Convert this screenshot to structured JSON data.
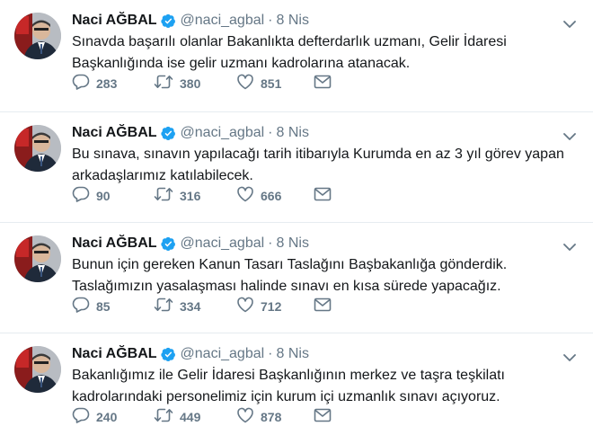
{
  "tweets": [
    {
      "name": "Naci AĞBAL",
      "handle": "@naci_agbal",
      "dot": "·",
      "time": "8 Nis",
      "line1": "Sınavda başarılı olanlar Bakanlıkta defterdarlık uzmanı, Gelir İdaresi",
      "line2": "Başkanlığında ise gelir uzmanı kadrolarına atanacak.",
      "replies": "283",
      "retweets": "380",
      "likes": "851"
    },
    {
      "name": "Naci AĞBAL",
      "handle": "@naci_agbal",
      "dot": "·",
      "time": "8 Nis",
      "line1": "Bu sınava, sınavın yapılacağı tarih itibarıyla Kurumda en az 3 yıl görev yapan",
      "line2": "arkadaşlarımız katılabilecek.",
      "replies": "90",
      "retweets": "316",
      "likes": "666"
    },
    {
      "name": "Naci AĞBAL",
      "handle": "@naci_agbal",
      "dot": "·",
      "time": "8 Nis",
      "line1": "Bunun için gereken Kanun Tasarı Taslağını Başbakanlığa gönderdik.",
      "line2": "Taslağımızın yasalaşması halinde sınavı en kısa sürede yapacağız.",
      "replies": "85",
      "retweets": "334",
      "likes": "712"
    },
    {
      "name": "Naci AĞBAL",
      "handle": "@naci_agbal",
      "dot": "·",
      "time": "8 Nis",
      "line1": "Bakanlığımız ile Gelir İdaresi Başkanlığının merkez ve taşra teşkilatı",
      "line2": "kadrolarındaki personelimiz için kurum içi uzmanlık sınavı açıyoruz.",
      "replies": "240",
      "retweets": "449",
      "likes": "878"
    }
  ],
  "icons": {
    "verified": "verified-badge-icon",
    "reply": "reply-icon",
    "retweet": "retweet-icon",
    "like": "heart-icon",
    "message": "direct-message-icon",
    "caret": "chevron-down-icon"
  },
  "colors": {
    "text": "#14171a",
    "secondary": "#657786",
    "verified": "#1da1f2",
    "divider": "#e6ecf0"
  }
}
